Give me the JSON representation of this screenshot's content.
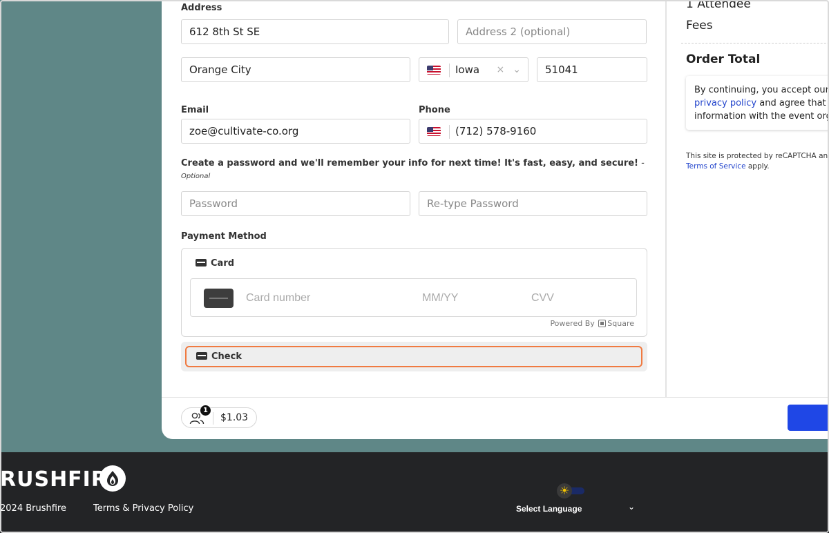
{
  "address": {
    "label": "Address",
    "line1_value": "612 8th St SE",
    "line2_placeholder": "Address 2 (optional)",
    "city_value": "Orange City",
    "state_value": "Iowa",
    "clear_glyph": "×",
    "zip_value": "51041"
  },
  "contact": {
    "email_label": "Email",
    "email_value": "zoe@cultivate-co.org",
    "phone_label": "Phone",
    "phone_value": "(712) 578-9160"
  },
  "password": {
    "hint": "Create a password and we'll remember your info for next time! It's fast, easy, and secure!",
    "hint_dash": " -",
    "optional": "Optional",
    "password_placeholder": "Password",
    "retype_placeholder": "Re-type Password"
  },
  "payment": {
    "label": "Payment Method",
    "card_label": "Card",
    "card_number_placeholder": "Card number",
    "expiry_placeholder": "MM/YY",
    "cvv_placeholder": "CVV",
    "powered_by": "Powered By",
    "square": "Square",
    "check_label": "Check"
  },
  "cart": {
    "count": "1",
    "total": "$1.03"
  },
  "summary": {
    "attendee": "1 Attendee",
    "fees": "Fees",
    "order_total": "Order Total",
    "consent_line1": "By continuing, you accept our",
    "privacy_link": "privacy policy",
    "consent_line2_rest": " and agree that",
    "consent_line3": "information with the event organizer",
    "recaptcha_line1": "This site is protected by reCAPTCHA and",
    "terms_link": "Terms of Service",
    "recaptcha_apply": " apply."
  },
  "footer": {
    "brand": "RUSHFIRE",
    "copyright": "2024 Brushfire",
    "terms": "Terms & Privacy Policy",
    "theme_icon": "☀",
    "language": "Select Language",
    "language_chevron": "⌄"
  },
  "colors": {
    "page_bg": "#5f8787",
    "primary": "#1f47e6",
    "focus_ring": "#f07a41",
    "footer_bg": "#232426",
    "link": "#2244cc"
  }
}
